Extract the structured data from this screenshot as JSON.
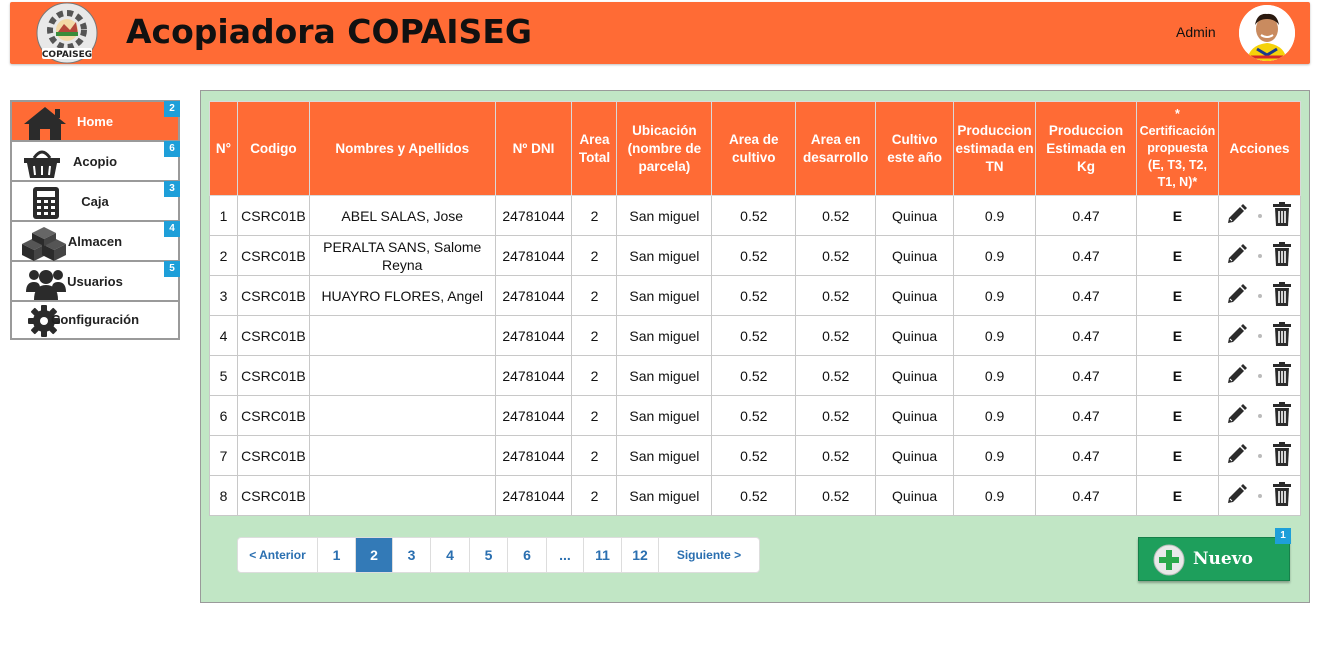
{
  "header": {
    "logo_text": "COPAISEG",
    "title": "Acopiadora COPAISEG",
    "user": "Admin",
    "accent_color": "#ff6b35"
  },
  "sidebar": {
    "items": [
      {
        "label": "Home",
        "badge": "2",
        "icon": "home-icon",
        "active": true
      },
      {
        "label": "Acopio",
        "badge": "6",
        "icon": "basket-icon",
        "active": false
      },
      {
        "label": "Caja",
        "badge": "3",
        "icon": "calculator-icon",
        "active": false
      },
      {
        "label": "Almacen",
        "badge": "4",
        "icon": "boxes-icon",
        "active": false
      },
      {
        "label": "Usuarios",
        "badge": "5",
        "icon": "users-icon",
        "active": false
      },
      {
        "label": "Configuración",
        "badge": "",
        "icon": "gear-icon",
        "active": false
      }
    ]
  },
  "table": {
    "columns": [
      "N°",
      "Codigo",
      "Nombres y Apellidos",
      "Nº DNI",
      "Area Total",
      "Ubicación (nombre de parcela)",
      "Area de cultivo",
      "Area en desarrollo",
      "Cultivo este año",
      "Produccion estimada en TN",
      "Produccion Estimada en Kg",
      "* Certificación propuesta (E, T3, T2, T1, N)*",
      "Acciones"
    ],
    "rows": [
      {
        "n": "1",
        "codigo": "CSRC01B",
        "nombre": "ABEL SALAS, Jose",
        "dni": "24781044",
        "area_total": "2",
        "ubicacion": "San miguel",
        "area_cultivo": "0.52",
        "area_desarrollo": "0.52",
        "cultivo": "Quinua",
        "prod_tn": "0.9",
        "prod_kg": "0.47",
        "cert": "E"
      },
      {
        "n": "2",
        "codigo": "CSRC01B",
        "nombre": "PERALTA SANS, Salome Reyna",
        "dni": "24781044",
        "area_total": "2",
        "ubicacion": "San miguel",
        "area_cultivo": "0.52",
        "area_desarrollo": "0.52",
        "cultivo": "Quinua",
        "prod_tn": "0.9",
        "prod_kg": "0.47",
        "cert": "E"
      },
      {
        "n": "3",
        "codigo": "CSRC01B",
        "nombre": "HUAYRO FLORES, Angel",
        "dni": "24781044",
        "area_total": "2",
        "ubicacion": "San miguel",
        "area_cultivo": "0.52",
        "area_desarrollo": "0.52",
        "cultivo": "Quinua",
        "prod_tn": "0.9",
        "prod_kg": "0.47",
        "cert": "E"
      },
      {
        "n": "4",
        "codigo": "CSRC01B",
        "nombre": "",
        "dni": "24781044",
        "area_total": "2",
        "ubicacion": "San miguel",
        "area_cultivo": "0.52",
        "area_desarrollo": "0.52",
        "cultivo": "Quinua",
        "prod_tn": "0.9",
        "prod_kg": "0.47",
        "cert": "E"
      },
      {
        "n": "5",
        "codigo": "CSRC01B",
        "nombre": "",
        "dni": "24781044",
        "area_total": "2",
        "ubicacion": "San miguel",
        "area_cultivo": "0.52",
        "area_desarrollo": "0.52",
        "cultivo": "Quinua",
        "prod_tn": "0.9",
        "prod_kg": "0.47",
        "cert": "E"
      },
      {
        "n": "6",
        "codigo": "CSRC01B",
        "nombre": "",
        "dni": "24781044",
        "area_total": "2",
        "ubicacion": "San miguel",
        "area_cultivo": "0.52",
        "area_desarrollo": "0.52",
        "cultivo": "Quinua",
        "prod_tn": "0.9",
        "prod_kg": "0.47",
        "cert": "E"
      },
      {
        "n": "7",
        "codigo": "CSRC01B",
        "nombre": "",
        "dni": "24781044",
        "area_total": "2",
        "ubicacion": "San miguel",
        "area_cultivo": "0.52",
        "area_desarrollo": "0.52",
        "cultivo": "Quinua",
        "prod_tn": "0.9",
        "prod_kg": "0.47",
        "cert": "E"
      },
      {
        "n": "8",
        "codigo": "CSRC01B",
        "nombre": "",
        "dni": "24781044",
        "area_total": "2",
        "ubicacion": "San miguel",
        "area_cultivo": "0.52",
        "area_desarrollo": "0.52",
        "cultivo": "Quinua",
        "prod_tn": "0.9",
        "prod_kg": "0.47",
        "cert": "E"
      }
    ]
  },
  "pagination": {
    "prev": "< Anterior",
    "next": "Siguiente >",
    "pages": [
      "1",
      "2",
      "3",
      "4",
      "5",
      "6",
      "...",
      "11",
      "12"
    ],
    "current": "2"
  },
  "new_button": {
    "label": "Nuevo",
    "badge": "1",
    "icon": "plus-circle-icon"
  }
}
